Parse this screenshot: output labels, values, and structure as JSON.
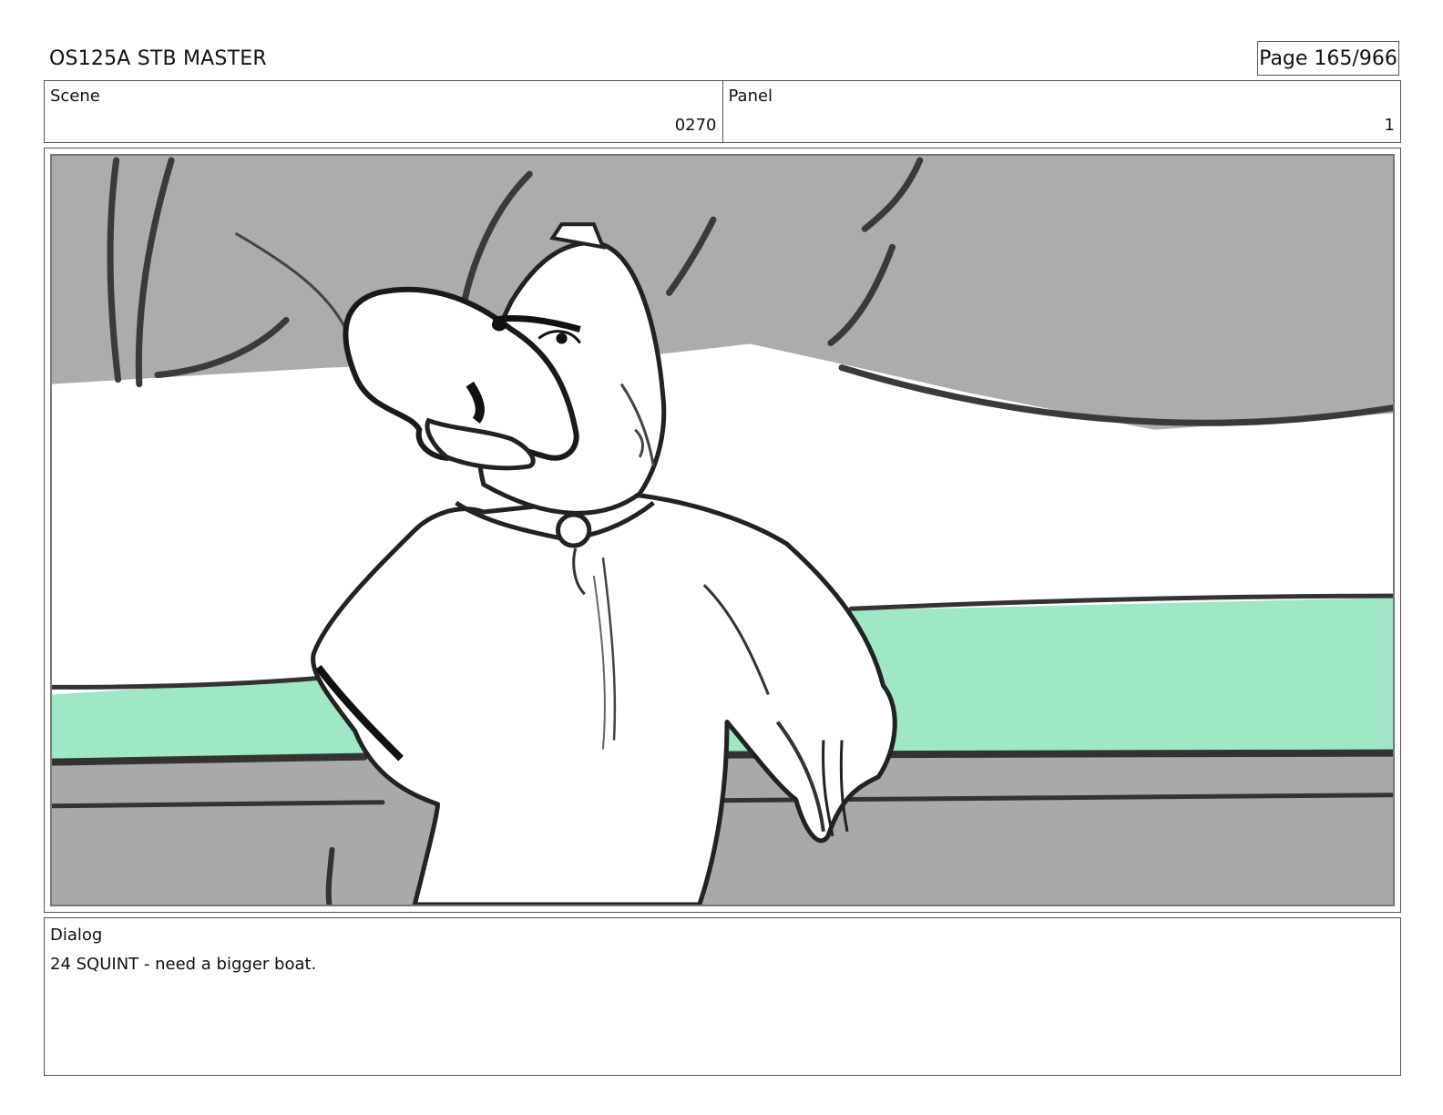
{
  "header": {
    "title": "OS125A STB MASTER",
    "page": "Page 165/966"
  },
  "scene": {
    "label": "Scene",
    "value": "0270"
  },
  "panel": {
    "label": "Panel",
    "value": "1"
  },
  "frame": {
    "colors": {
      "sky": "#acacac",
      "cloud": "#ffffff",
      "water": "#9fe7c6",
      "deck": "#a9a9a9",
      "line": "#2a2a2a"
    }
  },
  "dialog": {
    "label": "Dialog",
    "text": "24 SQUINT - need a bigger boat."
  }
}
